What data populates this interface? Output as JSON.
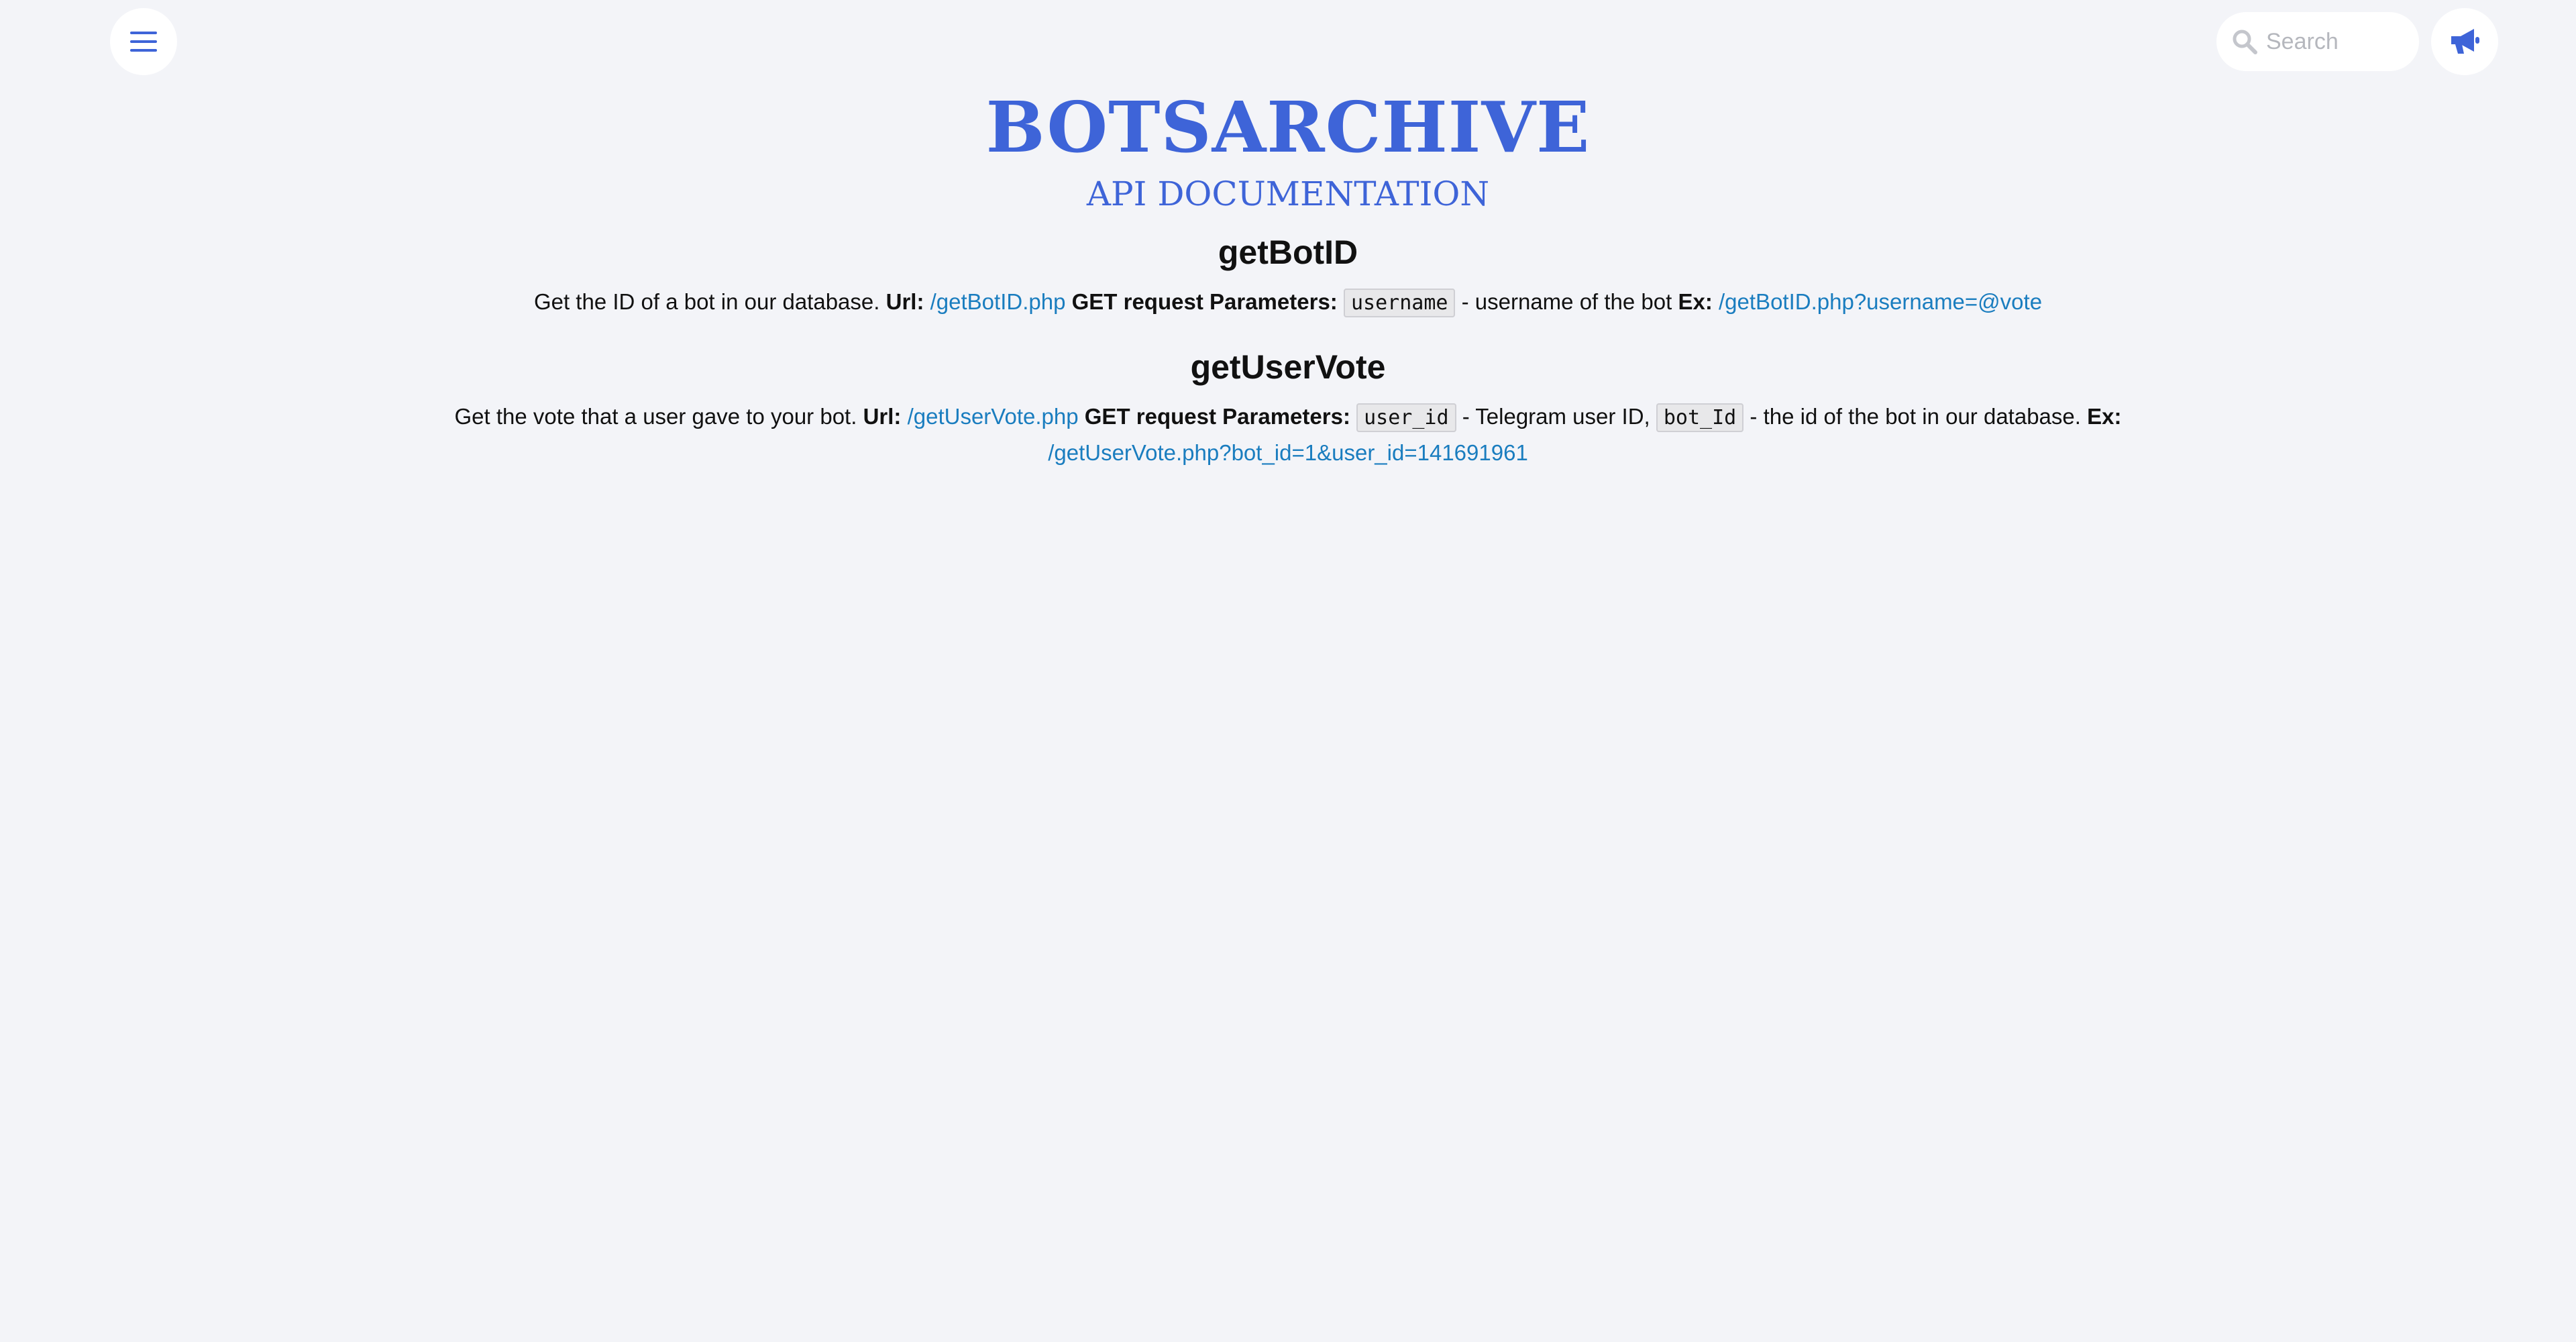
{
  "header": {
    "search_placeholder": "Search",
    "menu_icon": "hamburger-menu-icon",
    "search_icon": "magnifier-icon",
    "announce_icon": "megaphone-icon",
    "accent_color": "#3e64d8"
  },
  "brand": {
    "title": "BOTSARCHIVE",
    "subtitle": "API DOCUMENTATION"
  },
  "endpoints": [
    {
      "name": "getBotID",
      "description": "Get the ID of a bot in our database.",
      "url_label": "Url:",
      "url": "/getBotID.php",
      "method_label": "GET request",
      "params_label": "Parameters:",
      "params": [
        {
          "name": "username",
          "desc": "- username of the bot"
        }
      ],
      "example_label": "Ex:",
      "example": "/getBotID.php?username=@vote"
    },
    {
      "name": "getUserVote",
      "description": "Get the vote that a user gave to your bot.",
      "url_label": "Url:",
      "url": "/getUserVote.php",
      "method_label": "GET request",
      "params_label": "Parameters:",
      "params": [
        {
          "name": "user_id",
          "desc": "- Telegram user ID,"
        },
        {
          "name": "bot_Id",
          "desc": "- the id of the bot in our database."
        }
      ],
      "example_label": "Ex:",
      "example": "/getUserVote.php?bot_id=1&user_id=141691961"
    }
  ]
}
